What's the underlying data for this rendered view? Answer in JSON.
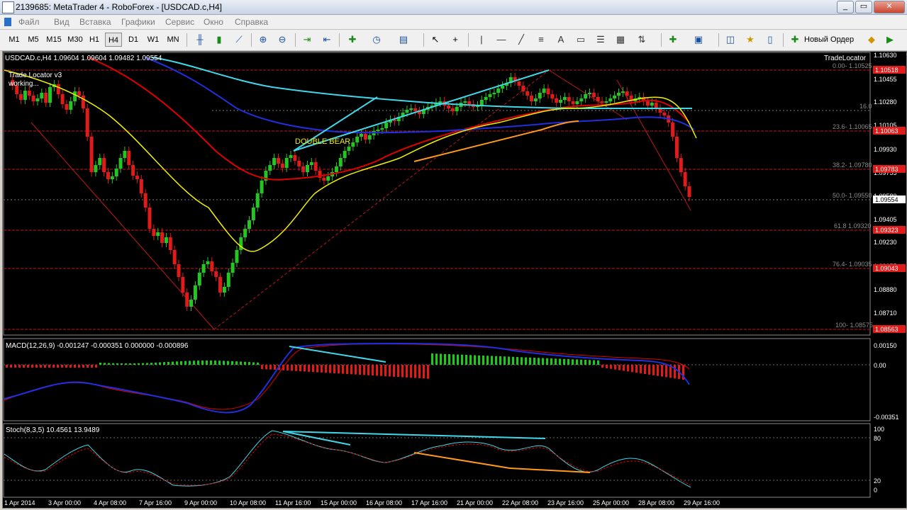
{
  "window": {
    "title": "2139685: MetaTrader 4 - RoboForex - [USDCAD.c,H4]"
  },
  "menu": [
    "Файл",
    "Вид",
    "Вставка",
    "Графики",
    "Сервис",
    "Окно",
    "Справка"
  ],
  "toolbar": {
    "timeframes": [
      "M1",
      "M5",
      "M15",
      "M30",
      "H1",
      "H4",
      "D1",
      "W1",
      "MN"
    ],
    "active_timeframe": "H4",
    "new_order_label": "Новый Ордер"
  },
  "chart": {
    "header": "USDCAD.c,H4  1.09604 1.09604 1.09482 1.09554",
    "indicator_label": "Trade Locator v3",
    "indicator_status": "working...",
    "indicator_name_right": "TradeLocator",
    "pattern_label": "DOUBLE  BEAR",
    "current_price": "1.09554",
    "price_ticks": [
      "1.10630",
      "1.10455",
      "1.10280",
      "1.10105",
      "1.09930",
      "1.09755",
      "1.09580",
      "1.09405",
      "1.09230",
      "1.09055",
      "1.08880",
      "1.08710"
    ],
    "fib_levels": [
      {
        "text": "0.00- 1.10525",
        "price_tag": "1.10518"
      },
      {
        "text": "16.0",
        "price_tag": ""
      },
      {
        "text": "23.6- 1.10065",
        "price_tag": "1.10063"
      },
      {
        "text": "38.2- 1.09780",
        "price_tag": "1.09783"
      },
      {
        "text": "50.0- 1.09550",
        "price_tag": ""
      },
      {
        "text": "61.8 1.09320",
        "price_tag": "1.09323"
      },
      {
        "text": "76.4- 1.09035",
        "price_tag": "1.09043"
      },
      {
        "text": "100- 1.08575",
        "price_tag": "1.08563"
      }
    ]
  },
  "macd": {
    "header": "MACD(12,26,9) -0.001247 -0.000351 0.000000 -0.000896",
    "ticks": [
      "0.00150",
      "0.00",
      "-0.00351"
    ]
  },
  "stoch": {
    "header": "Stoch(8,3,5) 10.4561 13.9489",
    "ticks": [
      "100",
      "80",
      "20",
      "0"
    ]
  },
  "time_axis": [
    "1 Apr 2014",
    "3 Apr 00:00",
    "4 Apr 08:00",
    "7 Apr 16:00",
    "9 Apr 00:00",
    "10 Apr 08:00",
    "11 Apr 16:00",
    "15 Apr 00:00",
    "16 Apr 08:00",
    "17 Apr 16:00",
    "21 Apr 00:00",
    "22 Apr 08:00",
    "23 Apr 16:00",
    "25 Apr 00:00",
    "28 Apr 08:00",
    "29 Apr 16:00"
  ],
  "colors": {
    "bull": "#22c722",
    "bear": "#e11a1a",
    "cyan": "#40d8e8",
    "yellow": "#f0f000",
    "red_ma": "#e00000",
    "blue_ma": "#2030e0",
    "orange": "#ff9a1a",
    "fib_line": "#c01818"
  }
}
